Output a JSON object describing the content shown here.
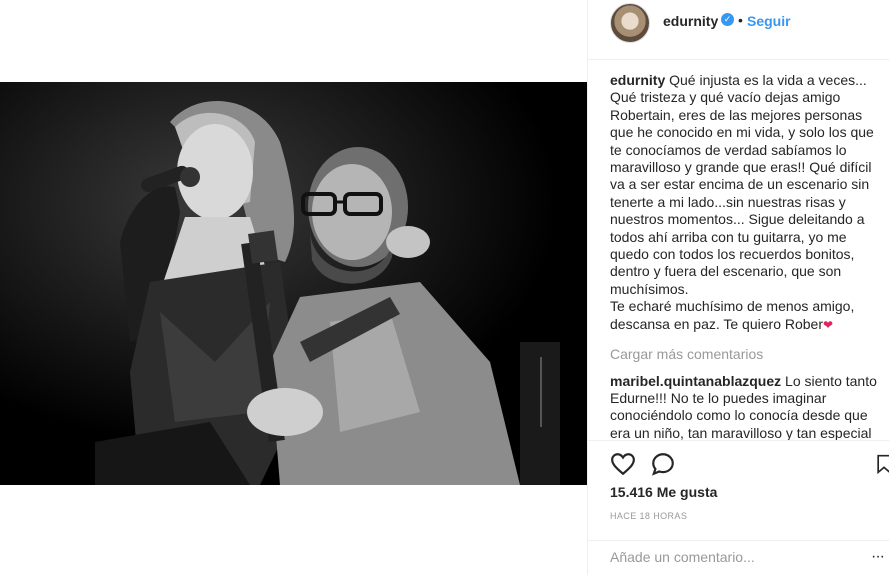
{
  "post": {
    "username": "edurnity",
    "verified_icon": "verified-badge-icon",
    "follow_label": "Seguir",
    "photo_description_icon": "photo"
  },
  "caption": {
    "username": "edurnity",
    "text": "Qué injusta es la vida a veces... Qué tristeza y qué vacío dejas amigo Robertain, eres de las mejores personas que he conocido en mi vida, y solo los que te conocíamos de verdad sabíamos lo maravilloso y grande que eras!! Qué difícil va a ser estar encima de un escenario sin tenerte a mi lado...sin nuestras risas y nuestros momentos... Sigue deleitando a todos ahí arriba con tu guitarra, yo me quedo con todos los recuerdos bonitos, dentro y fuera del escenario, que son muchísimos.",
    "text2": "Te echaré muchísimo de menos amigo, descansa en paz. Te quiero Rober",
    "emoji": "❤"
  },
  "load_more_label": "Cargar más comentarios",
  "comment": {
    "username": "maribel.quintanablazquez",
    "text": "Lo siento tanto Edurne!!! No te lo puedes imaginar conociéndolo como lo conocía desde que era un niño, tan maravilloso y tan especial"
  },
  "actions": {
    "like_icon": "heart-icon",
    "comment_icon": "comment-icon",
    "save_icon": "bookmark-icon"
  },
  "likes_label": "15.416 Me gusta",
  "timestamp": "HACE 18 HORAS",
  "add_comment": {
    "placeholder": "Añade un comentario...",
    "more_label": "···"
  },
  "colors": {
    "accent": "#3897f0",
    "text": "#262626",
    "muted": "#999999",
    "border": "#efefef"
  }
}
